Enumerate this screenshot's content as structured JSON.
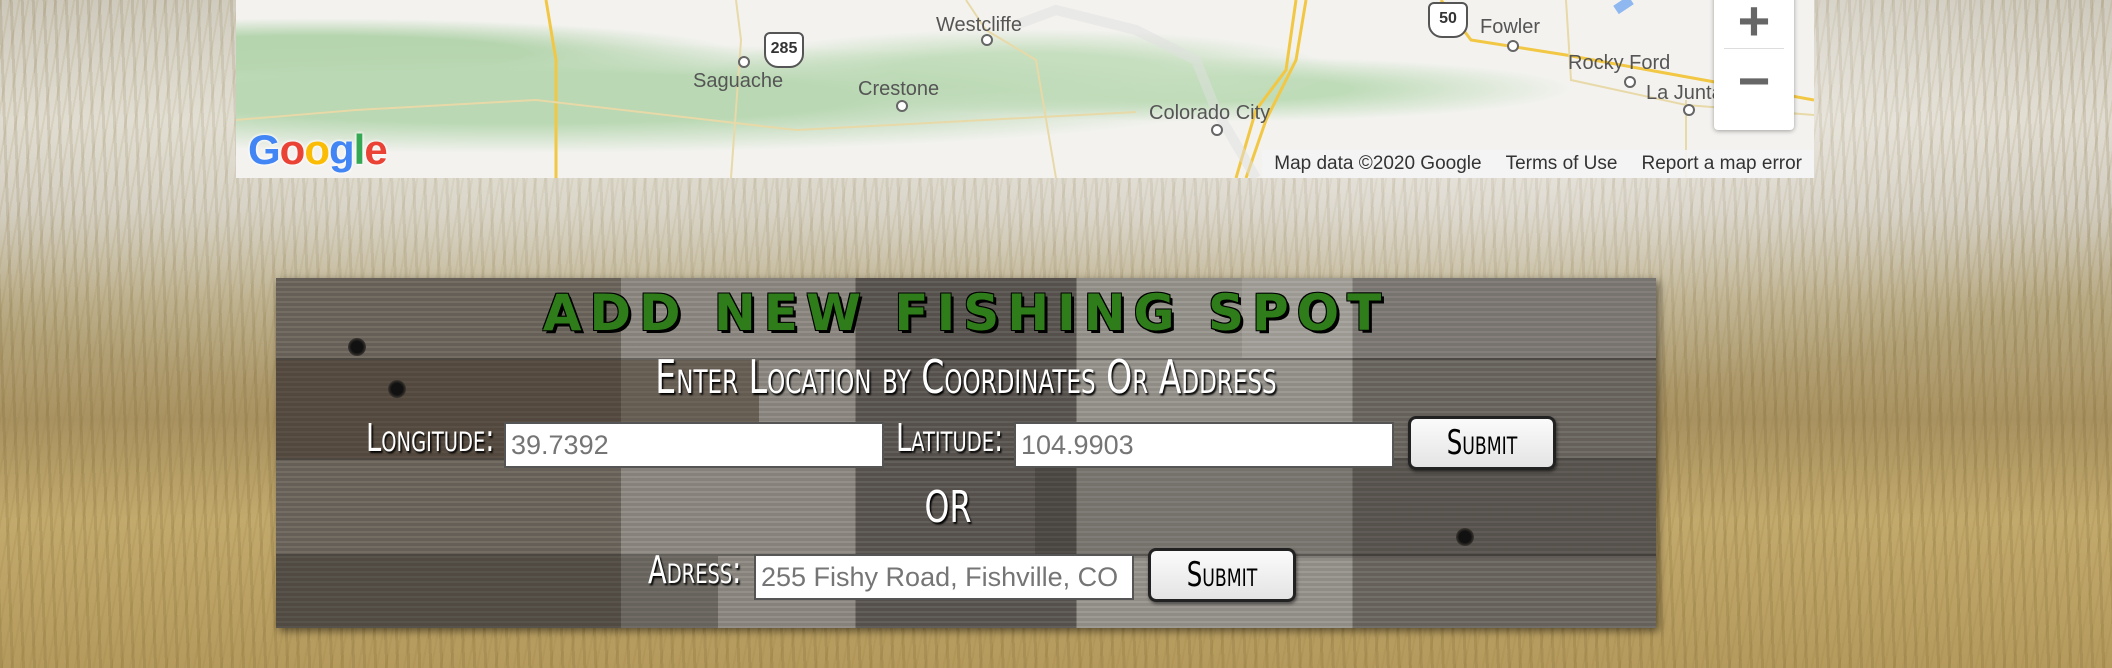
{
  "map": {
    "places": [
      {
        "name": "Westcliffe"
      },
      {
        "name": "Saguache"
      },
      {
        "name": "Crestone"
      },
      {
        "name": "Colorado City"
      },
      {
        "name": "Fowler"
      },
      {
        "name": "Rocky Ford"
      },
      {
        "name": "La Junta"
      }
    ],
    "route_shields": [
      {
        "number": "285"
      },
      {
        "number": "50"
      }
    ],
    "google_logo": "Google",
    "attribution": {
      "map_data": "Map data ©2020 Google",
      "terms": "Terms of Use",
      "report": "Report a map error"
    },
    "zoom": {
      "in_symbol": "+",
      "out_symbol": "−"
    }
  },
  "form": {
    "title": "ADD NEW FISHING SPOT",
    "subtitle": "Enter Location by Coordinates Or Address",
    "longitude_label": "Longitude:",
    "longitude_placeholder": "39.7392",
    "latitude_label": "Latitude:",
    "latitude_placeholder": "104.9903",
    "submit_label": "Submit",
    "or_label": "OR",
    "address_label": "Adress:",
    "address_placeholder": "255 Fishy Road, Fishville, CO",
    "address_submit_label": "Submit"
  },
  "colors": {
    "title_green": "#2f7d1a",
    "map_background": "#f3f2ef",
    "road_yellow": "#f2c744"
  }
}
